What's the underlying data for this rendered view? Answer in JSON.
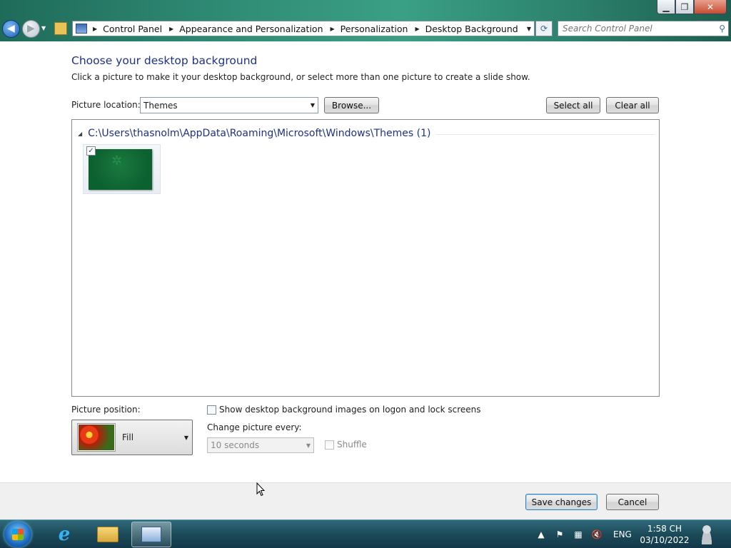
{
  "window": {
    "minimize_icon": "minimize-icon",
    "maximize_icon": "restore-icon",
    "close_icon": "close-icon"
  },
  "nav": {
    "back_icon": "back-arrow-icon",
    "forward_icon": "forward-arrow-icon"
  },
  "address": {
    "crumbs": [
      "Control Panel",
      "Appearance and Personalization",
      "Personalization",
      "Desktop Background"
    ],
    "search_placeholder": "Search Control Panel"
  },
  "page": {
    "title": "Choose your desktop background",
    "instructions": "Click a picture to make it your desktop background, or select more than one picture to create a slide show.",
    "picture_location_label": "Picture location:",
    "picture_location_value": "Themes",
    "browse_label": "Browse...",
    "select_all_label": "Select all",
    "clear_all_label": "Clear all"
  },
  "gallery": {
    "group_title": "C:\\Users\\thasnolm\\AppData\\Roaming\\Microsoft\\Windows\\Themes (1)",
    "items": [
      {
        "checked": true,
        "color": "#0c6130"
      }
    ]
  },
  "options": {
    "picture_position_label": "Picture position:",
    "picture_position_value": "Fill",
    "logon_checkbox_label": "Show desktop background images on logon and lock screens",
    "change_picture_label": "Change picture every:",
    "interval_value": "10 seconds",
    "shuffle_label": "Shuffle"
  },
  "footer": {
    "save_label": "Save changes",
    "cancel_label": "Cancel"
  },
  "taskbar": {
    "language": "ENG",
    "time": "1:58 CH",
    "date": "03/10/2022"
  },
  "colors": {
    "title_blue": "#1e3287",
    "taskbar": "#1c4a58",
    "accent_border": "#3c7fb1"
  }
}
